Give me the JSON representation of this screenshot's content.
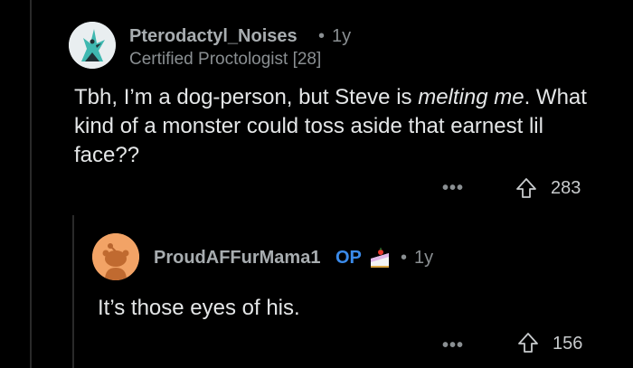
{
  "comment": {
    "username": "Pterodactyl_Noises",
    "separator": "•",
    "age": "1y",
    "flair": "Certified Proctologist [28]",
    "text_before": "Tbh, I’m a dog-person, but Steve is ",
    "text_emphasis": "melting me",
    "text_after": ". What kind of a monster could toss aside that earnest lil face??",
    "more_label": "•••",
    "score": "283",
    "avatar_icon": "pterodactyl-avatar-icon"
  },
  "reply": {
    "username": "ProudAFFurMama1",
    "op_label": "OP",
    "separator": "•",
    "age": "1y",
    "text": "It’s those eyes of his.",
    "more_label": "•••",
    "score": "156",
    "avatar_icon": "snoo-avatar-icon",
    "award_icon": "cake-award-icon"
  },
  "colors": {
    "background": "#000000",
    "text": "#e4e6e7",
    "muted": "#8a8f92",
    "op_accent": "#3b8beb"
  }
}
